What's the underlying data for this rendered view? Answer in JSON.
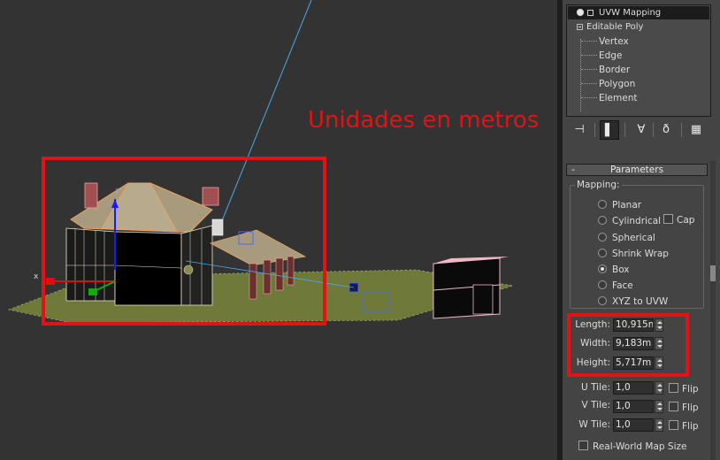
{
  "annotation": {
    "text": "Unidades en metros",
    "color": "#e01414"
  },
  "modifier_stack": {
    "items": [
      {
        "label": "UVW Mapping",
        "selected": true
      },
      {
        "label": "Editable Poly",
        "selected": false
      }
    ],
    "subobjects": [
      "Vertex",
      "Edge",
      "Border",
      "Polygon",
      "Element"
    ]
  },
  "toolbar": {
    "icons": [
      "pin-stack-icon",
      "show-end-result-icon",
      "make-unique-icon",
      "remove-modifier-icon",
      "configure-sets-icon"
    ]
  },
  "parameters": {
    "title": "Parameters",
    "collapse_symbol": "-",
    "mapping_label": "Mapping:",
    "mapping_options": [
      "Planar",
      "Cylindrical",
      "Spherical",
      "Shrink Wrap",
      "Box",
      "Face",
      "XYZ to UVW"
    ],
    "selected_mapping": "Box",
    "cap_label": "Cap",
    "length_label": "Length:",
    "length_value": "10,915m",
    "width_label": "Width:",
    "width_value": "9,183m",
    "height_label": "Height:",
    "height_value": "5,717m",
    "u_tile_label": "U Tile:",
    "u_tile_value": "1,0",
    "v_tile_label": "V Tile:",
    "v_tile_value": "1,0",
    "w_tile_label": "W Tile:",
    "w_tile_value": "1,0",
    "flip_label": "Flip",
    "real_world_label": "Real-World Map Size"
  },
  "viewport": {
    "axis_x_label": "x",
    "background_color": "#333333",
    "grass_color": "#6f7a3a",
    "wire_color": "#f0e6c8",
    "selection_color": "#e0782a"
  }
}
